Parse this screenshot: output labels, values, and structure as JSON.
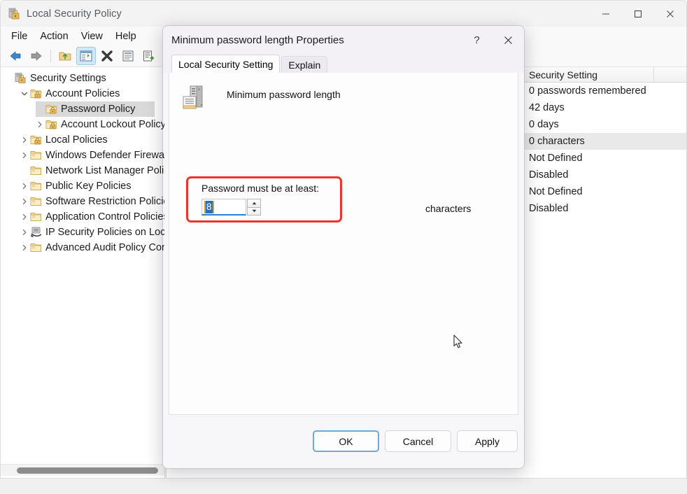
{
  "window": {
    "title": "Local Security Policy",
    "icon": "security-policy-icon",
    "controls": {
      "minimize": "minimize-icon",
      "maximize": "maximize-icon",
      "close": "close-icon"
    }
  },
  "menubar": {
    "items": [
      {
        "label": "File"
      },
      {
        "label": "Action"
      },
      {
        "label": "View"
      },
      {
        "label": "Help"
      }
    ]
  },
  "toolbar": {
    "buttons": [
      {
        "name": "back-button",
        "icon": "back-arrow-icon",
        "active": false
      },
      {
        "name": "forward-button",
        "icon": "forward-arrow-icon",
        "active": false
      },
      {
        "name": "up-one-level-button",
        "icon": "folder-up-icon",
        "active": false
      },
      {
        "name": "show-hide-console-tree-button",
        "icon": "console-tree-icon",
        "active": true
      },
      {
        "name": "delete-button",
        "icon": "delete-x-icon",
        "active": false
      },
      {
        "name": "properties-button",
        "icon": "properties-icon",
        "active": false
      },
      {
        "name": "export-list-button",
        "icon": "export-list-icon",
        "active": false
      }
    ]
  },
  "tree": {
    "items": [
      {
        "label": "Security Settings",
        "indent": 0,
        "twisty": "none",
        "icon": "security-settings-icon",
        "selected": false
      },
      {
        "label": "Account Policies",
        "indent": 1,
        "twisty": "expanded",
        "icon": "locked-folder-icon",
        "selected": false
      },
      {
        "label": "Password Policy",
        "indent": 2,
        "twisty": "none",
        "icon": "locked-folder-icon",
        "selected": true
      },
      {
        "label": "Account Lockout Policy",
        "indent": 2,
        "twisty": "collapsed",
        "icon": "locked-folder-icon",
        "selected": false
      },
      {
        "label": "Local Policies",
        "indent": 1,
        "twisty": "collapsed",
        "icon": "locked-folder-icon",
        "selected": false
      },
      {
        "label": "Windows Defender Firewall",
        "indent": 1,
        "twisty": "collapsed",
        "icon": "folder-icon",
        "selected": false
      },
      {
        "label": "Network List Manager Policies",
        "indent": 1,
        "twisty": "none",
        "icon": "folder-icon",
        "selected": false
      },
      {
        "label": "Public Key Policies",
        "indent": 1,
        "twisty": "collapsed",
        "icon": "folder-icon",
        "selected": false
      },
      {
        "label": "Software Restriction Policies",
        "indent": 1,
        "twisty": "collapsed",
        "icon": "folder-icon",
        "selected": false
      },
      {
        "label": "Application Control Policies",
        "indent": 1,
        "twisty": "collapsed",
        "icon": "folder-icon",
        "selected": false
      },
      {
        "label": "IP Security Policies on Local",
        "indent": 1,
        "twisty": "collapsed",
        "icon": "ip-security-icon",
        "selected": false
      },
      {
        "label": "Advanced Audit Policy Con",
        "indent": 1,
        "twisty": "collapsed",
        "icon": "folder-icon",
        "selected": false
      }
    ]
  },
  "list": {
    "column_header": "Security Setting",
    "rows": [
      {
        "value": "0 passwords remembered",
        "selected": false
      },
      {
        "value": "42 days",
        "selected": false
      },
      {
        "value": "0 days",
        "selected": false
      },
      {
        "value": "0 characters",
        "selected": true
      },
      {
        "value": "Not Defined",
        "selected": false
      },
      {
        "value": "Disabled",
        "selected": false
      },
      {
        "value": "Not Defined",
        "selected": false
      },
      {
        "value": "Disabled",
        "selected": false
      }
    ]
  },
  "dialog": {
    "title": "Minimum password length Properties",
    "help_label": "?",
    "close_label": "✕",
    "tabs": [
      {
        "label": "Local Security Setting",
        "active": true
      },
      {
        "label": "Explain",
        "active": false
      }
    ],
    "policy_icon": "computer-policy-icon",
    "policy_name": "Minimum password length",
    "field_label": "Password must be at least:",
    "field_value": "8",
    "unit_label": "characters",
    "spinner_up": "spinner-up-icon",
    "spinner_down": "spinner-down-icon",
    "buttons": [
      {
        "label": "OK",
        "name": "ok-button",
        "primary": true
      },
      {
        "label": "Cancel",
        "name": "cancel-button",
        "primary": false
      },
      {
        "label": "Apply",
        "name": "apply-button",
        "primary": false
      }
    ]
  },
  "annotation": {
    "color": "#f0342c",
    "target": "password-length-field-group"
  },
  "colors": {
    "accent": "#2a7fd4",
    "selection_blue": "#2a6fbb",
    "tree_selection": "#d9d9d9",
    "window_bg": "#f3f3f3",
    "dialog_bg": "#f7f6f9"
  }
}
